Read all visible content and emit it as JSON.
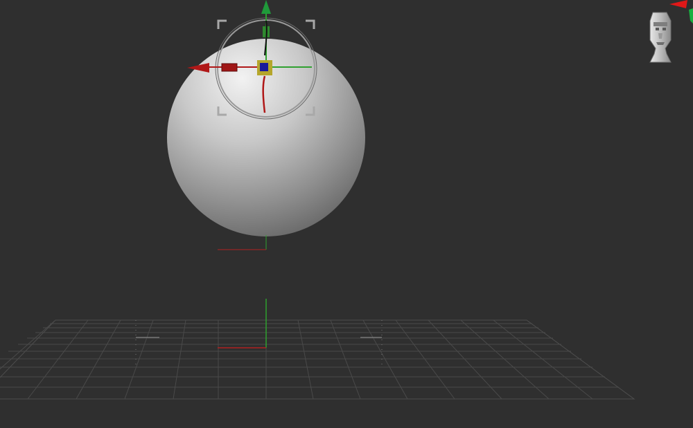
{
  "app": {
    "name": "3D viewport",
    "background_color": "#2f2f2f"
  },
  "scene": {
    "object": "sphere",
    "floor_grid": "visible",
    "gizmo": "transpose-move",
    "navigation_widget": "head-icon",
    "axis_colors": {
      "x": "#cc1a1a",
      "y": "#2fa02f",
      "z": "#1a1a9a"
    },
    "highlight_color": "#b5a62b"
  }
}
